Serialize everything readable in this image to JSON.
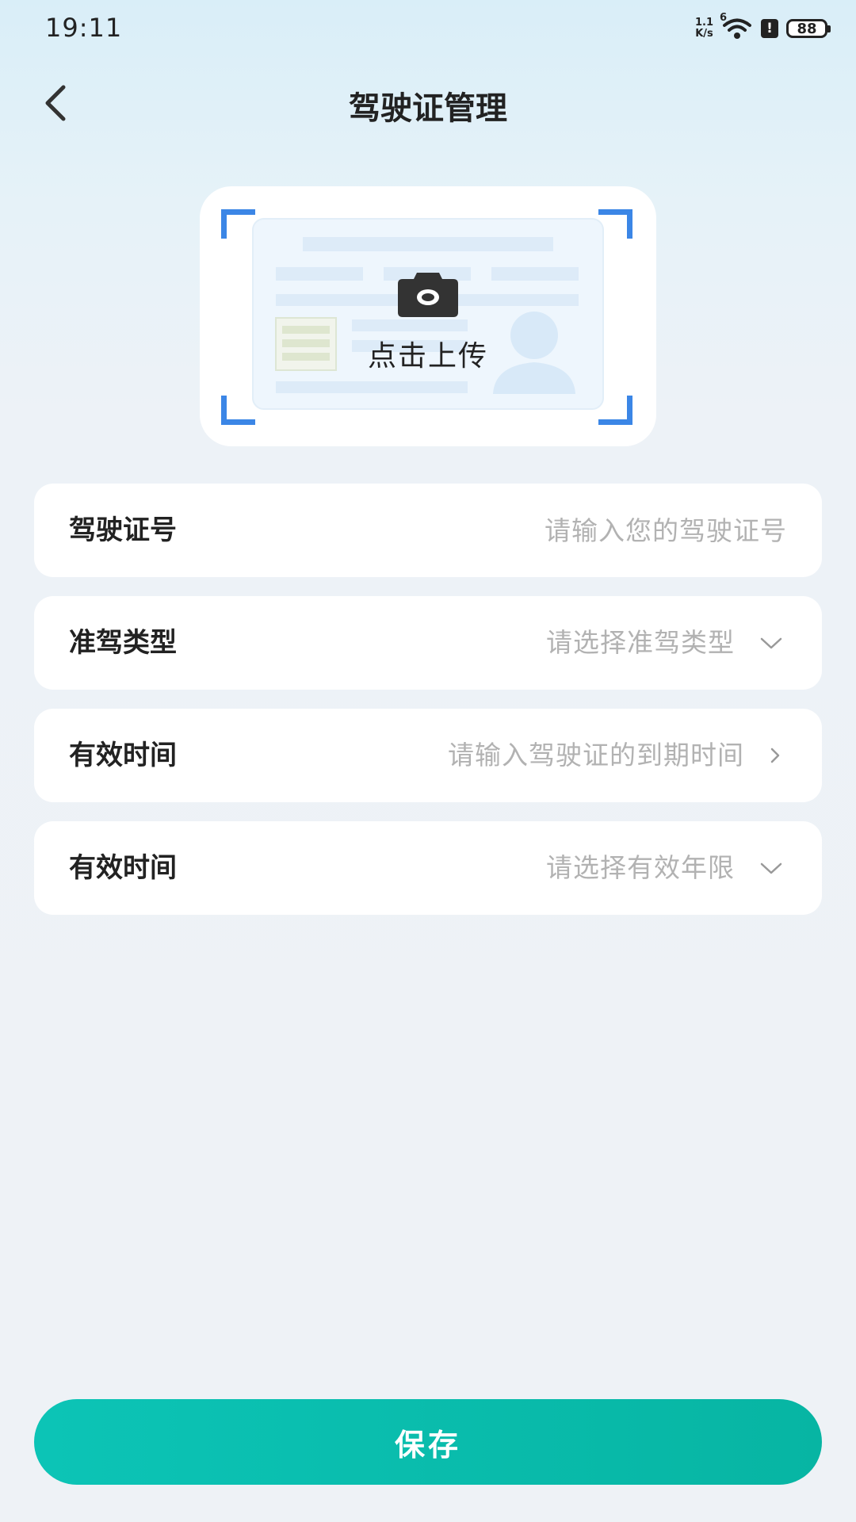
{
  "status_bar": {
    "time": "19:11",
    "net_speed_value": "1.1",
    "net_speed_unit": "K/s",
    "network_type": "6",
    "battery_level": "88"
  },
  "header": {
    "title": "驾驶证管理",
    "back_icon": "chevron-left-icon"
  },
  "upload": {
    "label": "点击上传",
    "icon": "camera-icon",
    "accent_color": "#3b86e6"
  },
  "form": {
    "license_number": {
      "label": "驾驶证号",
      "placeholder": "请输入您的驾驶证号",
      "value": ""
    },
    "license_type": {
      "label": "准驾类型",
      "placeholder": "请选择准驾类型"
    },
    "expiry_date": {
      "label": "有效时间",
      "placeholder": "请输入驾驶证的到期时间"
    },
    "validity_period": {
      "label": "有效时间",
      "placeholder": "请选择有效年限"
    }
  },
  "save_button": {
    "label": "保存",
    "color": "#0cc4b6"
  }
}
